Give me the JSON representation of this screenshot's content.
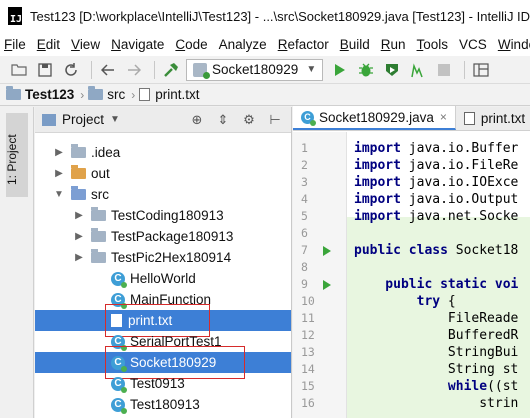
{
  "window": {
    "title": "Test123 [D:\\workplace\\IntelliJ\\Test123] - ...\\src\\Socket180929.java [Test123] - IntelliJ IDEA",
    "app_icon": "IJ"
  },
  "menu": [
    {
      "label": "File",
      "u": "F",
      "rest": "ile"
    },
    {
      "label": "Edit",
      "u": "E",
      "rest": "dit"
    },
    {
      "label": "View",
      "u": "V",
      "rest": "iew"
    },
    {
      "label": "Navigate",
      "u": "N",
      "rest": "avigate"
    },
    {
      "label": "Code",
      "u": "C",
      "rest": "ode"
    },
    {
      "label": "Analyze",
      "u": "",
      "rest": "Analyze"
    },
    {
      "label": "Refactor",
      "u": "R",
      "rest": "efactor"
    },
    {
      "label": "Build",
      "u": "B",
      "rest": "uild"
    },
    {
      "label": "Run",
      "u": "R",
      "rest": "un"
    },
    {
      "label": "Tools",
      "u": "T",
      "rest": "ools"
    },
    {
      "label": "VCS",
      "u": "",
      "rest": "VCS"
    },
    {
      "label": "Window",
      "u": "W",
      "rest": "indow"
    }
  ],
  "toolbar": {
    "run_config": "Socket180929"
  },
  "navbar": {
    "project": "Test123",
    "folder": "src",
    "file": "print.txt"
  },
  "left_strip": {
    "label": "1: Project"
  },
  "project_panel": {
    "title": "Project",
    "tree": [
      {
        "label": ".idea",
        "type": "folder",
        "indent": 1,
        "arrow": "▶"
      },
      {
        "label": "out",
        "type": "folder-out",
        "indent": 1,
        "arrow": "▶"
      },
      {
        "label": "src",
        "type": "folder-src",
        "indent": 1,
        "arrow": "▼"
      },
      {
        "label": "TestCoding180913",
        "type": "folder",
        "indent": 2,
        "arrow": "▶"
      },
      {
        "label": "TestPackage180913",
        "type": "folder",
        "indent": 2,
        "arrow": "▶"
      },
      {
        "label": "TestPic2Hex180914",
        "type": "folder",
        "indent": 2,
        "arrow": "▶"
      },
      {
        "label": "HelloWorld",
        "type": "class",
        "indent": 3,
        "arrow": ""
      },
      {
        "label": "MainFunction",
        "type": "class",
        "indent": 3,
        "arrow": ""
      },
      {
        "label": "print.txt",
        "type": "txt",
        "indent": 3,
        "arrow": "",
        "selected": true,
        "boxed": true
      },
      {
        "label": "SerialPortTest1",
        "type": "class",
        "indent": 3,
        "arrow": ""
      },
      {
        "label": "Socket180929",
        "type": "class",
        "indent": 3,
        "arrow": "",
        "selected": true,
        "boxed": true
      },
      {
        "label": "Test0913",
        "type": "class",
        "indent": 3,
        "arrow": ""
      },
      {
        "label": "Test180913",
        "type": "class",
        "indent": 3,
        "arrow": ""
      }
    ]
  },
  "editor": {
    "tabs": [
      {
        "label": "Socket180929.java",
        "active": true,
        "icon": "class"
      },
      {
        "label": "print.txt",
        "active": false,
        "icon": "txt"
      }
    ],
    "line_numbers": [
      "1",
      "2",
      "3",
      "4",
      "5",
      "6",
      "7",
      "8",
      "9",
      "10",
      "11",
      "12",
      "13",
      "14",
      "15",
      "16"
    ],
    "run_marker_lines": [
      7,
      9
    ],
    "code_lines": [
      [
        {
          "t": "import ",
          "k": true
        },
        {
          "t": "java.io.Buffer",
          "k": false
        }
      ],
      [
        {
          "t": "import ",
          "k": true
        },
        {
          "t": "java.io.FileRe",
          "k": false
        }
      ],
      [
        {
          "t": "import ",
          "k": true
        },
        {
          "t": "java.io.IOExce",
          "k": false
        }
      ],
      [
        {
          "t": "import ",
          "k": true
        },
        {
          "t": "java.io.Output",
          "k": false
        }
      ],
      [
        {
          "t": "import ",
          "k": true
        },
        {
          "t": "java.net.Socke",
          "k": false
        }
      ],
      [
        {
          "t": "",
          "k": false
        }
      ],
      [
        {
          "t": "public class ",
          "k": true
        },
        {
          "t": "Socket18",
          "k": false
        }
      ],
      [
        {
          "t": "",
          "k": false
        }
      ],
      [
        {
          "t": "    public static ",
          "k": true
        },
        {
          "t": "voi",
          "k": true
        }
      ],
      [
        {
          "t": "        try ",
          "k": true
        },
        {
          "t": "{",
          "k": false
        }
      ],
      [
        {
          "t": "            FileReade",
          "k": false
        }
      ],
      [
        {
          "t": "            BufferedR",
          "k": false
        }
      ],
      [
        {
          "t": "            StringBui",
          "k": false
        }
      ],
      [
        {
          "t": "            String st",
          "k": false
        }
      ],
      [
        {
          "t": "            while",
          "k": true
        },
        {
          "t": "((st",
          "k": false
        }
      ],
      [
        {
          "t": "                strin",
          "k": false
        }
      ]
    ]
  }
}
